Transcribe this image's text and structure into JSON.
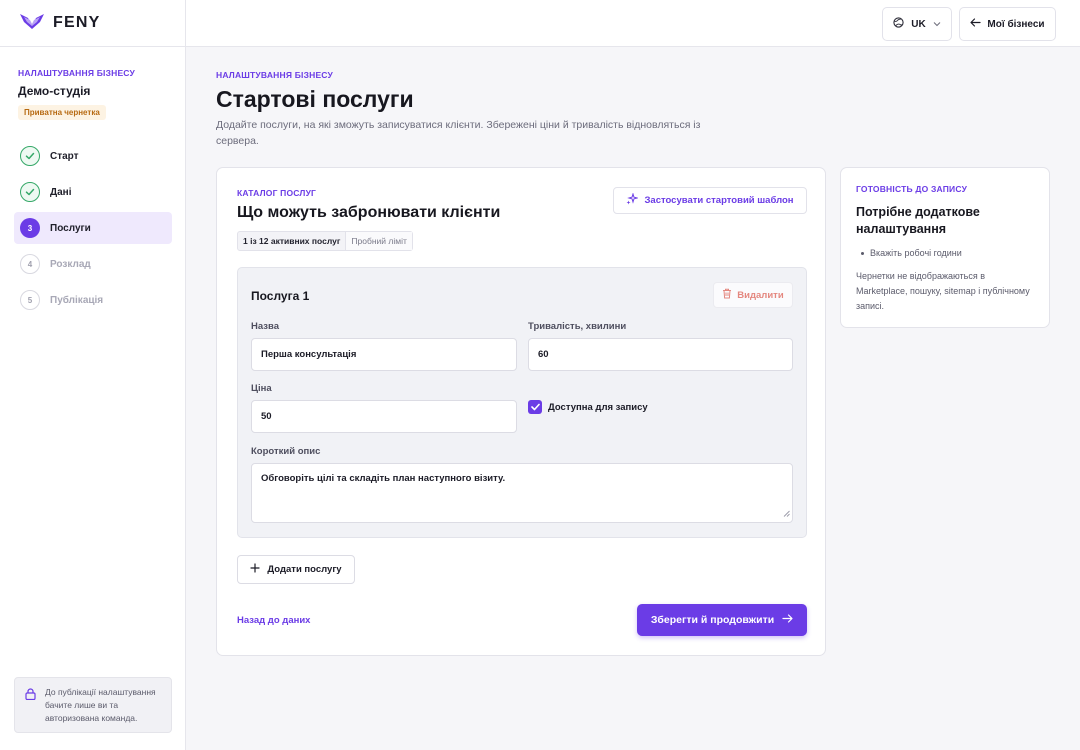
{
  "brand": {
    "name": "FENY"
  },
  "sidebar": {
    "eyebrow": "НАЛАШТУВАННЯ БІЗНЕСУ",
    "business_name": "Демо-студія",
    "draft_badge": "Приватна чернетка",
    "steps": [
      {
        "number": "1",
        "label": "Старт",
        "state": "done"
      },
      {
        "number": "2",
        "label": "Дані",
        "state": "done"
      },
      {
        "number": "3",
        "label": "Послуги",
        "state": "current"
      },
      {
        "number": "4",
        "label": "Розклад",
        "state": "pending"
      },
      {
        "number": "5",
        "label": "Публікація",
        "state": "pending"
      }
    ],
    "privacy_note": "До публікації налаштування бачите лише ви та авторизована команда."
  },
  "topbar": {
    "language": "UK",
    "back_label": "Мої бізнеси"
  },
  "header": {
    "eyebrow": "НАЛАШТУВАННЯ БІЗНЕСУ",
    "title": "Стартові послуги",
    "description": "Додайте послуги, на які зможуть записуватися клієнти. Збережені ціни й тривалість відновляться із сервера."
  },
  "catalog": {
    "eyebrow": "КАТАЛОГ ПОСЛУГ",
    "title": "Що можуть забронювати клієнти",
    "limit_count": "1 із 12 активних послуг",
    "limit_plan": "Пробний ліміт",
    "template_button": "Застосувати стартовий шаблон",
    "service": {
      "title": "Послуга 1",
      "delete_label": "Видалити",
      "name_label": "Назва",
      "name_value": "Перша консультація",
      "duration_label": "Тривалість, хвилини",
      "duration_value": "60",
      "price_label": "Ціна",
      "price_value": "50",
      "bookable_label": "Доступна для запису",
      "bookable_checked": true,
      "description_label": "Короткий опис",
      "description_value": "Обговоріть цілі та складіть план наступного візиту."
    },
    "add_button": "Додати послугу",
    "back_link": "Назад до даних",
    "save_button": "Зберегти й продовжити"
  },
  "readiness": {
    "eyebrow": "ГОТОВНІСТЬ ДО ЗАПИСУ",
    "title": "Потрібне додаткове налаштування",
    "items": [
      "Вкажіть робочі години"
    ],
    "note": "Чернетки не відображаються в Marketplace, пошуку, sitemap і публічному записі."
  },
  "colors": {
    "accent": "#6b3ce6",
    "success": "#35a868",
    "danger": "#e4877f",
    "warning_bg": "#fdf3e3"
  }
}
